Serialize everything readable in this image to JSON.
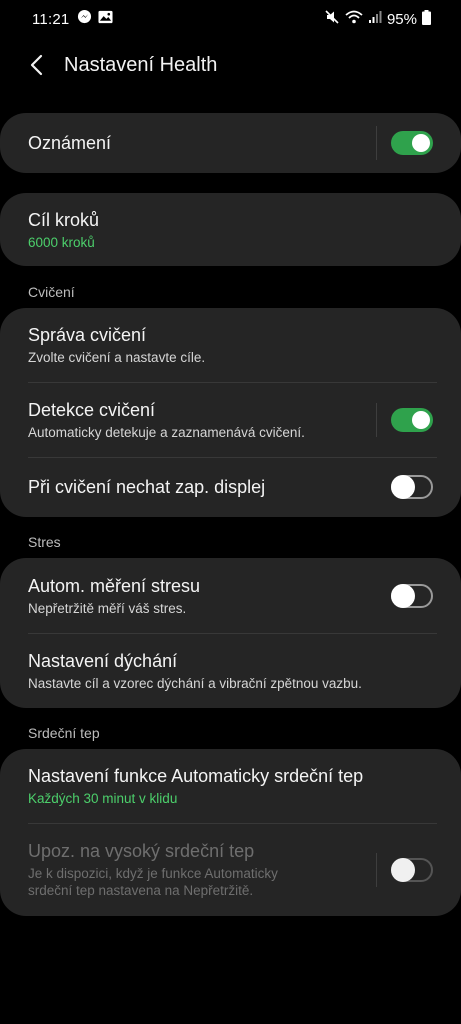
{
  "status": {
    "time": "11:21",
    "battery": "95%"
  },
  "header": {
    "title": "Nastavení Health"
  },
  "notifications": {
    "label": "Oznámení",
    "enabled": true
  },
  "steps": {
    "title": "Cíl kroků",
    "value": "6000 kroků"
  },
  "sections": {
    "exercise": "Cvičení",
    "stress": "Stres",
    "heart": "Srdeční tep"
  },
  "exercise": {
    "manage_title": "Správa cvičení",
    "manage_sub": "Zvolte cvičení a nastavte cíle.",
    "detect_title": "Detekce cvičení",
    "detect_sub": "Automaticky detekuje a zaznamenává cvičení.",
    "detect_enabled": true,
    "screen_title": "Při cvičení nechat zap. displej",
    "screen_enabled": false
  },
  "stress": {
    "auto_title": "Autom. měření stresu",
    "auto_sub": "Nepřetržitě měří váš stres.",
    "auto_enabled": false,
    "breath_title": "Nastavení dýchání",
    "breath_sub": "Nastavte cíl a vzorec dýchání a vibrační zpětnou vazbu."
  },
  "heart": {
    "auto_title": "Nastavení funkce Automaticky srdeční tep",
    "auto_sub": "Každých 30 minut v klidu",
    "high_title": "Upoz. na vysoký srdeční tep",
    "high_sub_line1": "Je k dispozici, když je funkce Automaticky",
    "high_sub_line2": "srdeční tep nastavena na Nepřetržitě.",
    "high_enabled": false
  },
  "colors": {
    "accent_green": "#4ccf6b",
    "toggle_on": "#2fa24c",
    "card_bg": "#252525"
  },
  "icons": [
    "messenger-icon",
    "gallery-icon",
    "mute-icon",
    "wifi-icon",
    "signal-icon",
    "battery-icon",
    "back-arrow-icon"
  ]
}
